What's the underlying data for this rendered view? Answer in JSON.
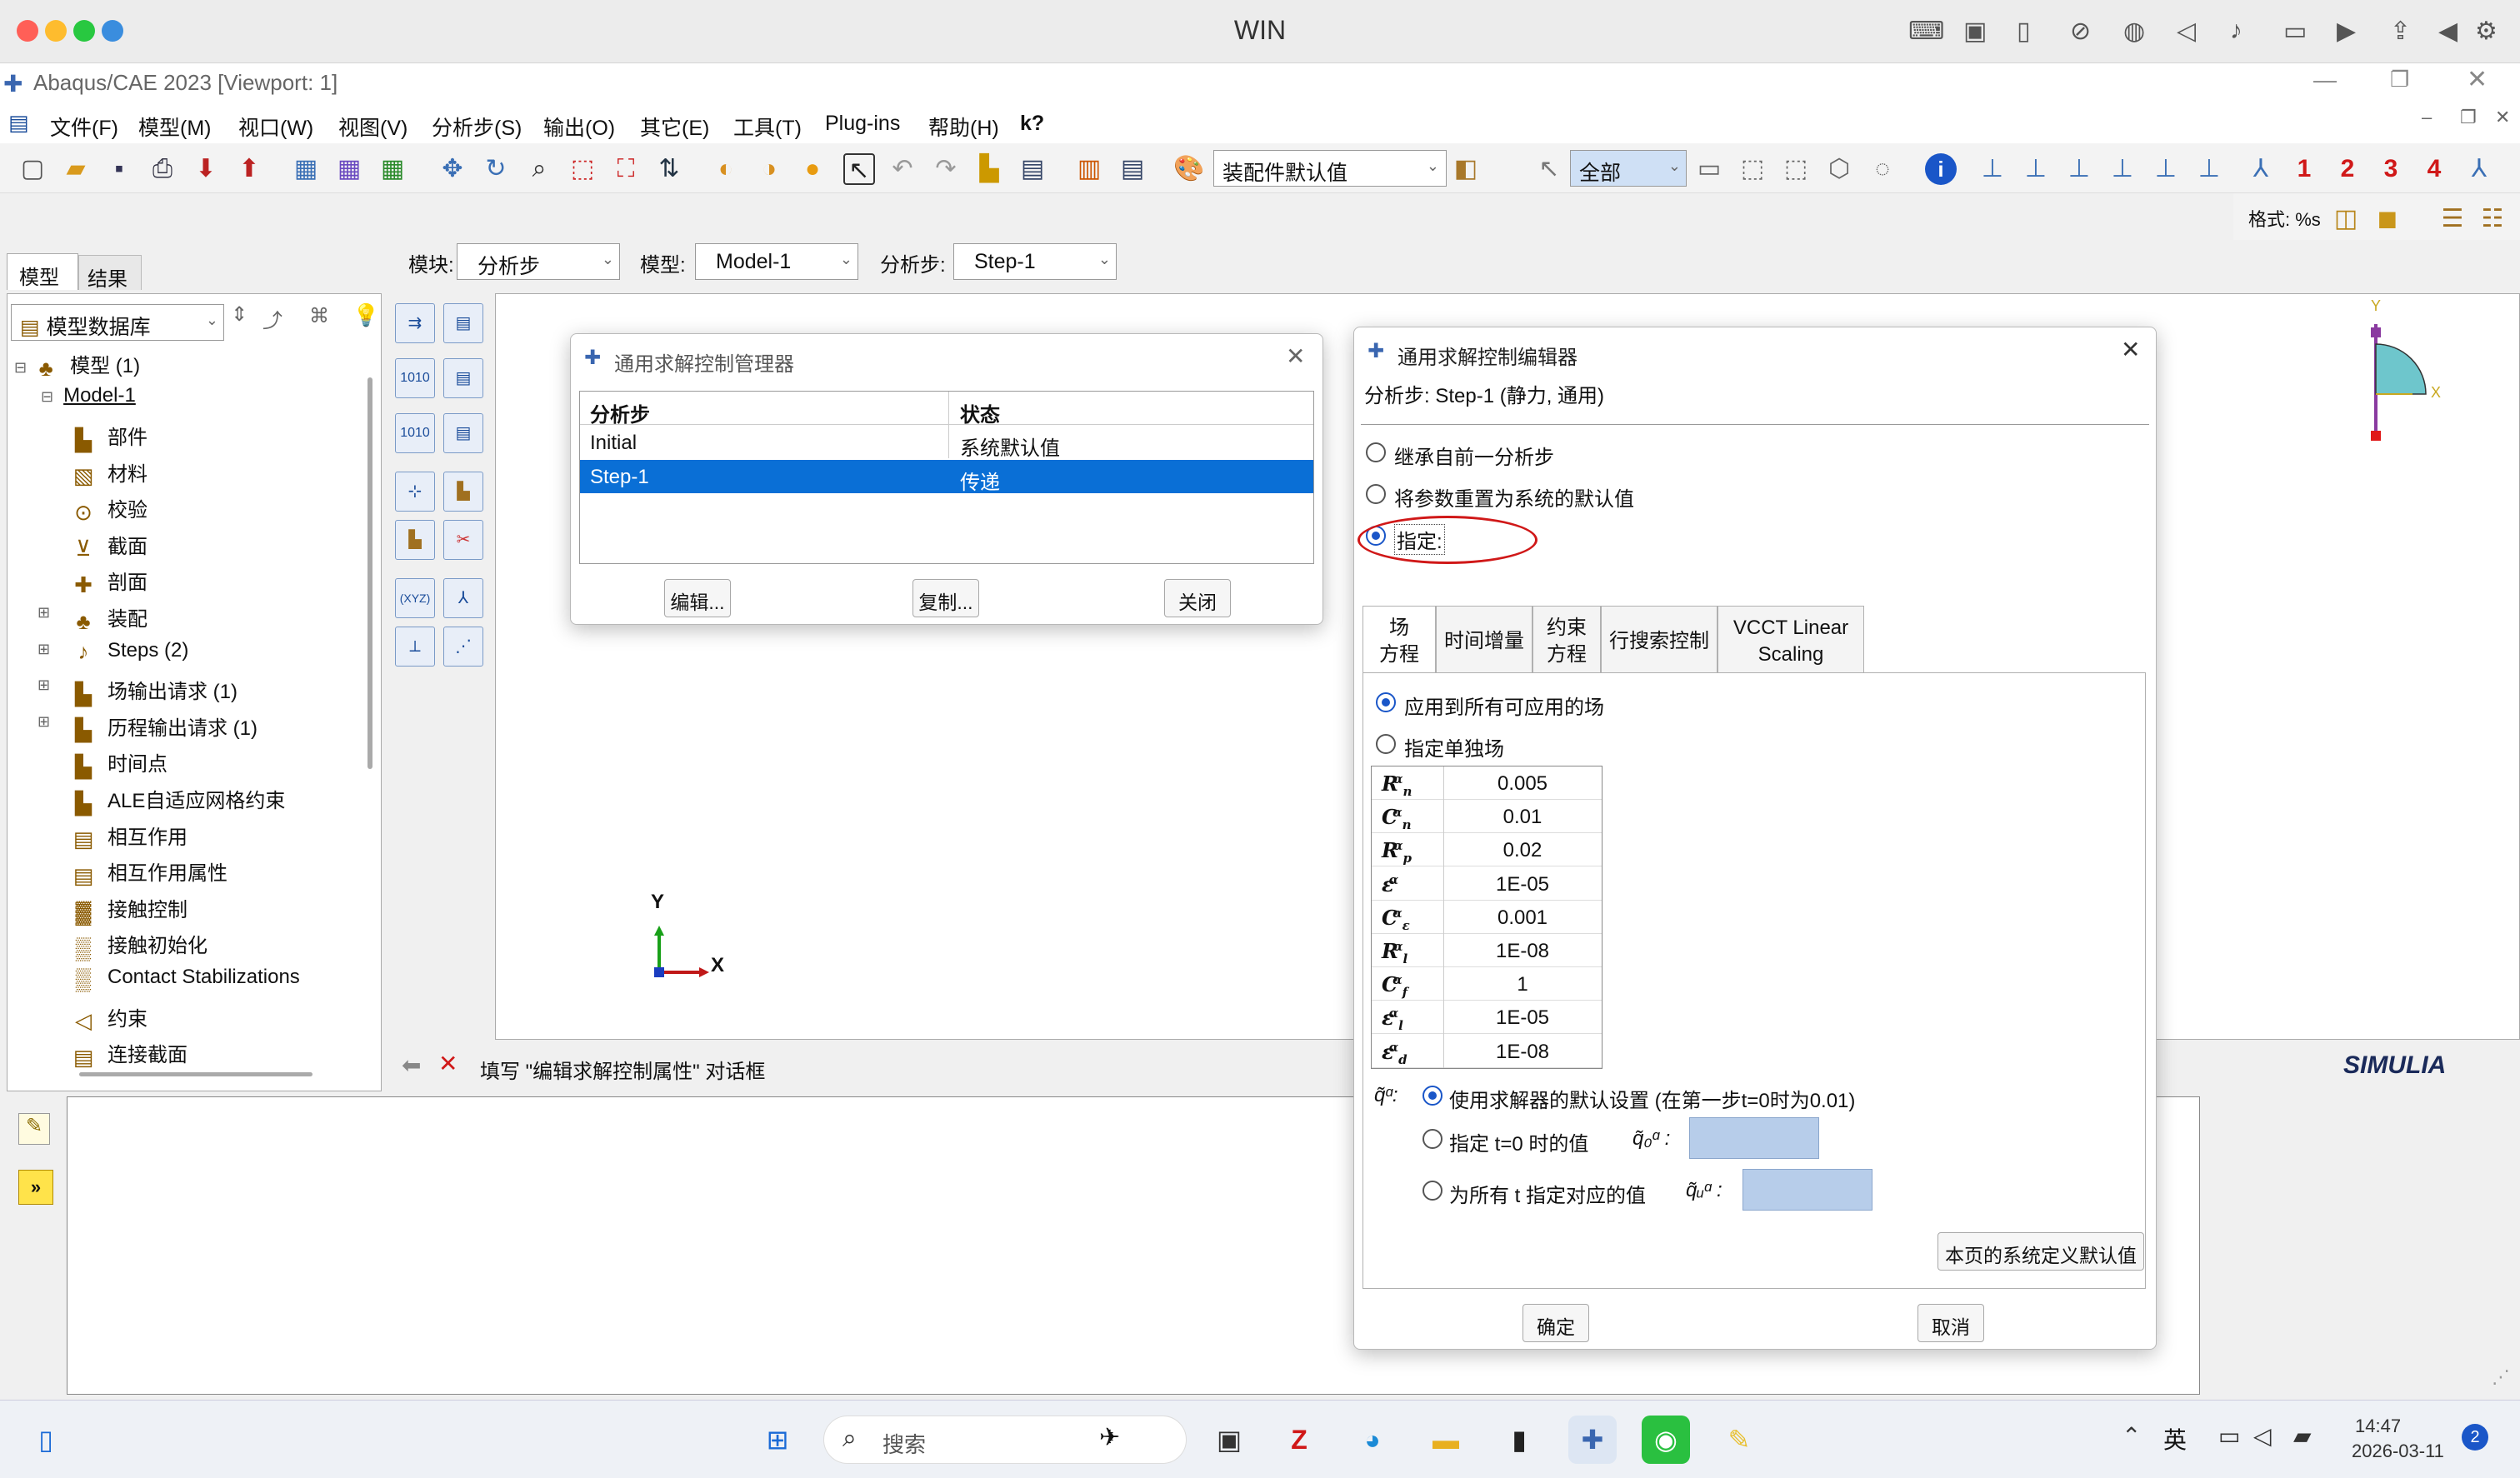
{
  "mac": {
    "title": "WIN"
  },
  "app": {
    "title": "Abaqus/CAE 2023 [Viewport: 1]"
  },
  "menu": [
    "文件(F)",
    "模型(M)",
    "视口(W)",
    "视图(V)",
    "分析步(S)",
    "输出(O)",
    "其它(E)",
    "工具(T)",
    "Plug-ins",
    "帮助(H)",
    "k?"
  ],
  "toolbar": {
    "assembly_default": "装配件默认值",
    "select_all": "全部",
    "views": [
      "1",
      "2",
      "3",
      "4"
    ],
    "format": "格式: %s"
  },
  "context": {
    "module_label": "模块:",
    "module": "分析步",
    "model_label": "模型:",
    "model": "Model-1",
    "step_label": "分析步:",
    "step": "Step-1"
  },
  "left_tabs": [
    "模型",
    "结果"
  ],
  "tree": {
    "db": "模型数据库",
    "root": "模型 (1)",
    "model": "Model-1",
    "items": [
      "部件",
      "材料",
      "校验",
      "截面",
      "剖面",
      "装配",
      "Steps (2)",
      "场输出请求 (1)",
      "历程输出请求 (1)",
      "时间点",
      "ALE自适应网格约束",
      "相互作用",
      "相互作用属性",
      "接触控制",
      "接触初始化",
      "Contact Stabilizations",
      "约束",
      "连接截面"
    ]
  },
  "prompt": {
    "text": "填写 \"编辑求解控制属性\" 对话框"
  },
  "triad": {
    "y": "Y",
    "x": "X"
  },
  "mini_triad": {
    "y": "Y",
    "x": "X"
  },
  "brand": "SIMULIA",
  "manager": {
    "title": "通用求解控制管理器",
    "col_step": "分析步",
    "col_status": "状态",
    "rows": [
      {
        "step": "Initial",
        "status": "系统默认值"
      },
      {
        "step": "Step-1",
        "status": "传递"
      }
    ],
    "buttons": {
      "edit": "编辑...",
      "copy": "复制...",
      "close": "关闭"
    }
  },
  "editor": {
    "title": "通用求解控制编辑器",
    "step_line": "分析步: Step-1 (静力, 通用)",
    "options": [
      "继承自前一分析步",
      "将参数重置为系统的默认值",
      "指定:"
    ],
    "tabs": [
      "场\n方程",
      "时间增量",
      "约束\n方程",
      "行搜索控制",
      "VCCT Linear\nScaling"
    ],
    "apply_all": "应用到所有可应用的场",
    "apply_single": "指定单独场",
    "params": [
      {
        "sym": "R",
        "sub": "n",
        "val": "0.005"
      },
      {
        "sym": "C",
        "sub": "n",
        "val": "0.01"
      },
      {
        "sym": "R",
        "sub": "p",
        "val": "0.02"
      },
      {
        "sym": "ε",
        "sub": "",
        "val": "1E-05"
      },
      {
        "sym": "C",
        "sub": "ε",
        "val": "0.001"
      },
      {
        "sym": "R",
        "sub": "l",
        "val": "1E-08"
      },
      {
        "sym": "C",
        "sub": "f",
        "val": "1"
      },
      {
        "sym": "ε",
        "sub": "l",
        "val": "1E-05"
      },
      {
        "sym": "ε",
        "sub": "d",
        "val": "1E-08"
      }
    ],
    "q_label": "q̃ᵅ:",
    "q_default": "使用求解器的默认设置  (在第一步t=0时为0.01)",
    "q_t0": "指定 t=0 时的值",
    "q_t0_sym": "q̃₀ᵅ :",
    "q_all": "为所有 t 指定对应的值",
    "q_all_sym": "q̃ᵤᵅ :",
    "reset_page": "本页的系统定义默认值",
    "ok": "确定",
    "cancel": "取消"
  },
  "taskbar": {
    "search": "搜索",
    "time": "14:47",
    "date": "2026-03-11",
    "lang": "英",
    "badge": "2"
  }
}
